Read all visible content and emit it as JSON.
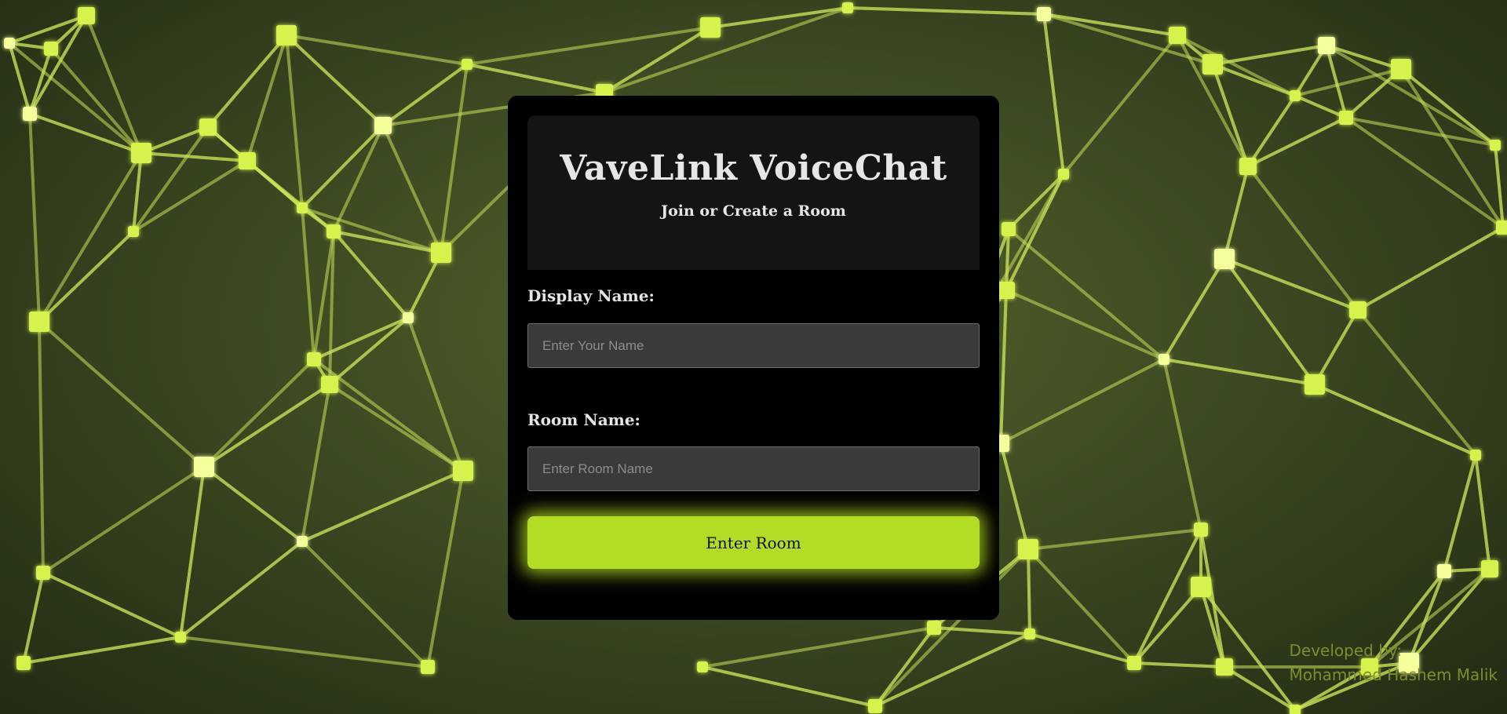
{
  "theme": {
    "accent": "#b1dd26",
    "card_background": "#000000",
    "header_background": "#141414",
    "input_background": "#3a3a3a",
    "text_color": "#e6e6e6",
    "credit_color": "#7d8d2e"
  },
  "background": {
    "icon": "network-mesh-background"
  },
  "header": {
    "title": "VaveLink VoiceChat",
    "subtitle": "Join or Create a Room"
  },
  "form": {
    "display_name": {
      "label": "Display Name:",
      "value": "",
      "placeholder": "Enter Your Name"
    },
    "room_name": {
      "label": "Room Name:",
      "value": "",
      "placeholder": "Enter Room Name"
    },
    "submit_label": "Enter Room"
  },
  "footer": {
    "line1": "Developed by:",
    "line2": "Mohammed Hashem Malik"
  }
}
